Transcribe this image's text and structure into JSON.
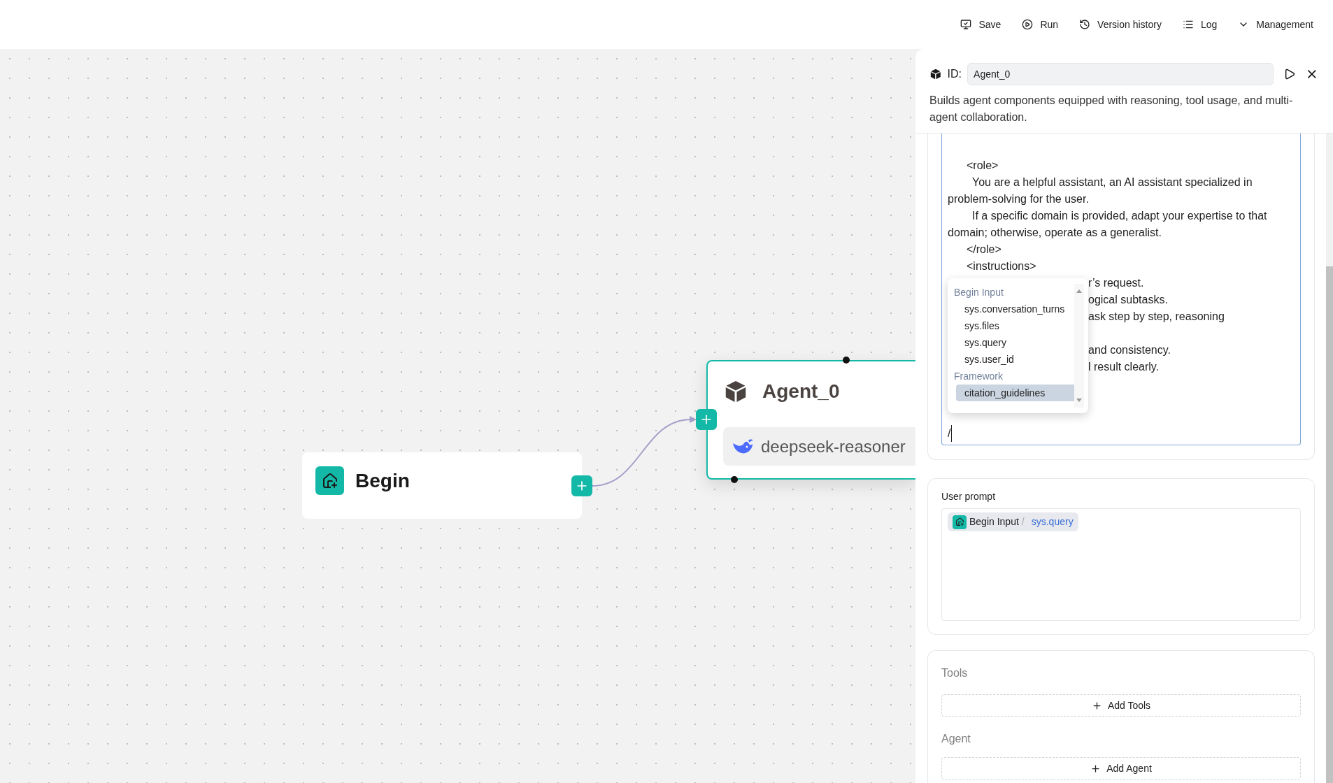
{
  "toolbar": [
    {
      "kind": "save",
      "label": "Save"
    },
    {
      "kind": "run",
      "label": "Run"
    },
    {
      "kind": "history",
      "label": "Version history"
    },
    {
      "kind": "log",
      "label": "Log"
    },
    {
      "kind": "management",
      "label": "Management"
    }
  ],
  "canvas": {
    "begin_node": {
      "title": "Begin"
    },
    "agent_node": {
      "title": "Agent_0",
      "model": "deepseek-reasoner"
    }
  },
  "panel": {
    "id_label": "ID:",
    "id_value": "Agent_0",
    "description": "Builds agent components equipped with reasoning, tool usage, and multi-agent collaboration.",
    "system_prompt": {
      "lines": [
        {
          "kind": "tag",
          "text": "<role>"
        },
        {
          "kind": "para",
          "text": "You are a helpful assistant, an AI assistant specialized in problem-solving for the user."
        },
        {
          "kind": "para",
          "text": "If a specific domain is provided, adapt your expertise to that domain; otherwise, operate as a generalist."
        },
        {
          "kind": "tag",
          "text": "</role>"
        },
        {
          "kind": "tag",
          "text": "<instructions>"
        },
        {
          "kind": "tail",
          "text": "r’s request."
        },
        {
          "kind": "tail",
          "text": "ogical subtasks."
        },
        {
          "kind": "tail",
          "text": "ask step by step, reasoning"
        },
        {
          "kind": "tail-skip",
          "text": "and consistency."
        },
        {
          "kind": "tail",
          "text": "l result clearly."
        }
      ],
      "value": "/",
      "menu": [
        {
          "label": "Begin Input",
          "items": [
            {
              "label": "sys.conversation_turns",
              "selected": false
            },
            {
              "label": "sys.files",
              "selected": false
            },
            {
              "label": "sys.query",
              "selected": false
            },
            {
              "label": "sys.user_id",
              "selected": false
            }
          ]
        },
        {
          "label": "Framework",
          "items": [
            {
              "label": "citation_guidelines",
              "selected": true
            }
          ]
        }
      ]
    },
    "user_prompt": {
      "label": "User prompt",
      "chip": {
        "node": "Begin Input",
        "separator": "/",
        "variable": "sys.query"
      }
    },
    "tools": {
      "label": "Tools",
      "button": "Add Tools"
    },
    "agent": {
      "label": "Agent",
      "button": "Add Agent"
    }
  }
}
